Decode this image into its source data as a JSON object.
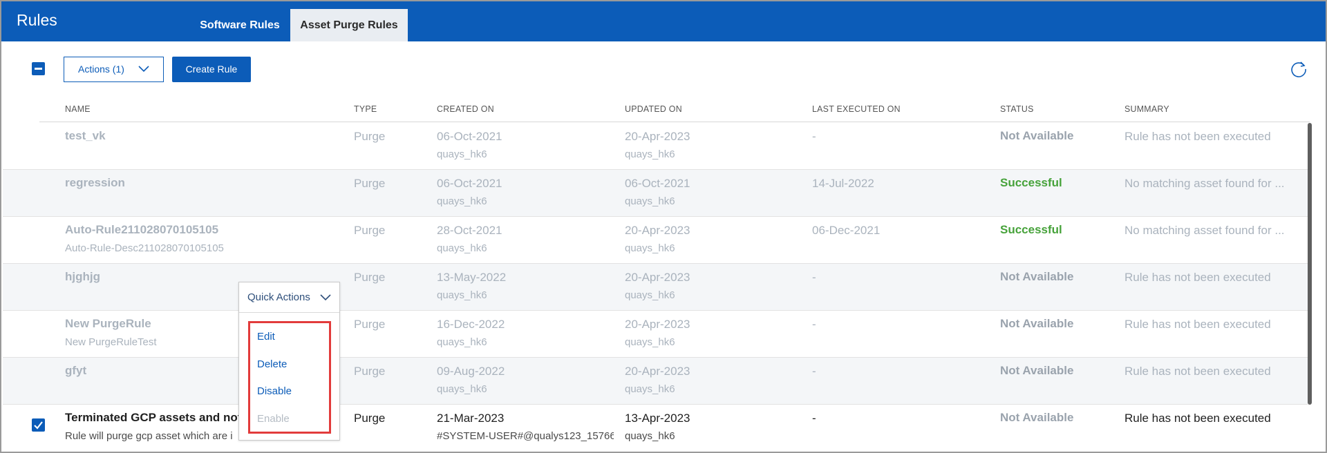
{
  "header": {
    "title": "Rules",
    "tabs": [
      {
        "label": "Software Rules"
      },
      {
        "label": "Asset Purge Rules"
      }
    ]
  },
  "toolbar": {
    "actions_label": "Actions (1)",
    "create_label": "Create Rule"
  },
  "table": {
    "columns": [
      "NAME",
      "TYPE",
      "CREATED ON",
      "UPDATED ON",
      "LAST EXECUTED ON",
      "STATUS",
      "SUMMARY"
    ],
    "rows": [
      {
        "name": "test_vk",
        "desc": "",
        "type": "Purge",
        "created": "06-Oct-2021",
        "created_by": "quays_hk6",
        "updated": "20-Apr-2023",
        "updated_by": "quays_hk6",
        "last_executed": "-",
        "status": "Not Available",
        "summary": "Rule has not been executed"
      },
      {
        "name": "regression",
        "desc": "",
        "type": "Purge",
        "created": "06-Oct-2021",
        "created_by": "quays_hk6",
        "updated": "06-Oct-2021",
        "updated_by": "quays_hk6",
        "last_executed": "14-Jul-2022",
        "status": "Successful",
        "summary": "No matching asset found for ..."
      },
      {
        "name": "Auto-Rule211028070105105",
        "desc": "Auto-Rule-Desc211028070105105",
        "type": "Purge",
        "created": "28-Oct-2021",
        "created_by": "quays_hk6",
        "updated": "20-Apr-2023",
        "updated_by": "quays_hk6",
        "last_executed": "06-Dec-2021",
        "status": "Successful",
        "summary": "No matching asset found for ..."
      },
      {
        "name": "hjghjg",
        "desc": "",
        "type": "Purge",
        "created": "13-May-2022",
        "created_by": "quays_hk6",
        "updated": "20-Apr-2023",
        "updated_by": "quays_hk6",
        "last_executed": "-",
        "status": "Not Available",
        "summary": "Rule has not been executed"
      },
      {
        "name": "New PurgeRule",
        "desc": "New PurgeRuleTest",
        "type": "Purge",
        "created": "16-Dec-2022",
        "created_by": "quays_hk6",
        "updated": "20-Apr-2023",
        "updated_by": "quays_hk6",
        "last_executed": "-",
        "status": "Not Available",
        "summary": "Rule has not been executed"
      },
      {
        "name": "gfyt",
        "desc": "",
        "type": "Purge",
        "created": "09-Aug-2022",
        "created_by": "quays_hk6",
        "updated": "20-Apr-2023",
        "updated_by": "quays_hk6",
        "last_executed": "-",
        "status": "Not Available",
        "summary": "Rule has not been executed"
      },
      {
        "name": "Terminated GCP assets and not",
        "desc": "Rule will purge gcp asset which are i",
        "type": "Purge",
        "created": "21-Mar-2023",
        "created_by": "#SYSTEM-USER#@qualys123_15766",
        "updated": "13-Apr-2023",
        "updated_by": "quays_hk6",
        "last_executed": "-",
        "status": "Not Available",
        "summary": "Rule has not been executed"
      }
    ]
  },
  "quick_actions": {
    "label": "Quick Actions",
    "items": [
      "Edit",
      "Delete",
      "Disable",
      "Enable"
    ]
  },
  "colors": {
    "brand": "#0c5cb8",
    "success": "#46a23a",
    "highlight": "#e23b3b"
  }
}
